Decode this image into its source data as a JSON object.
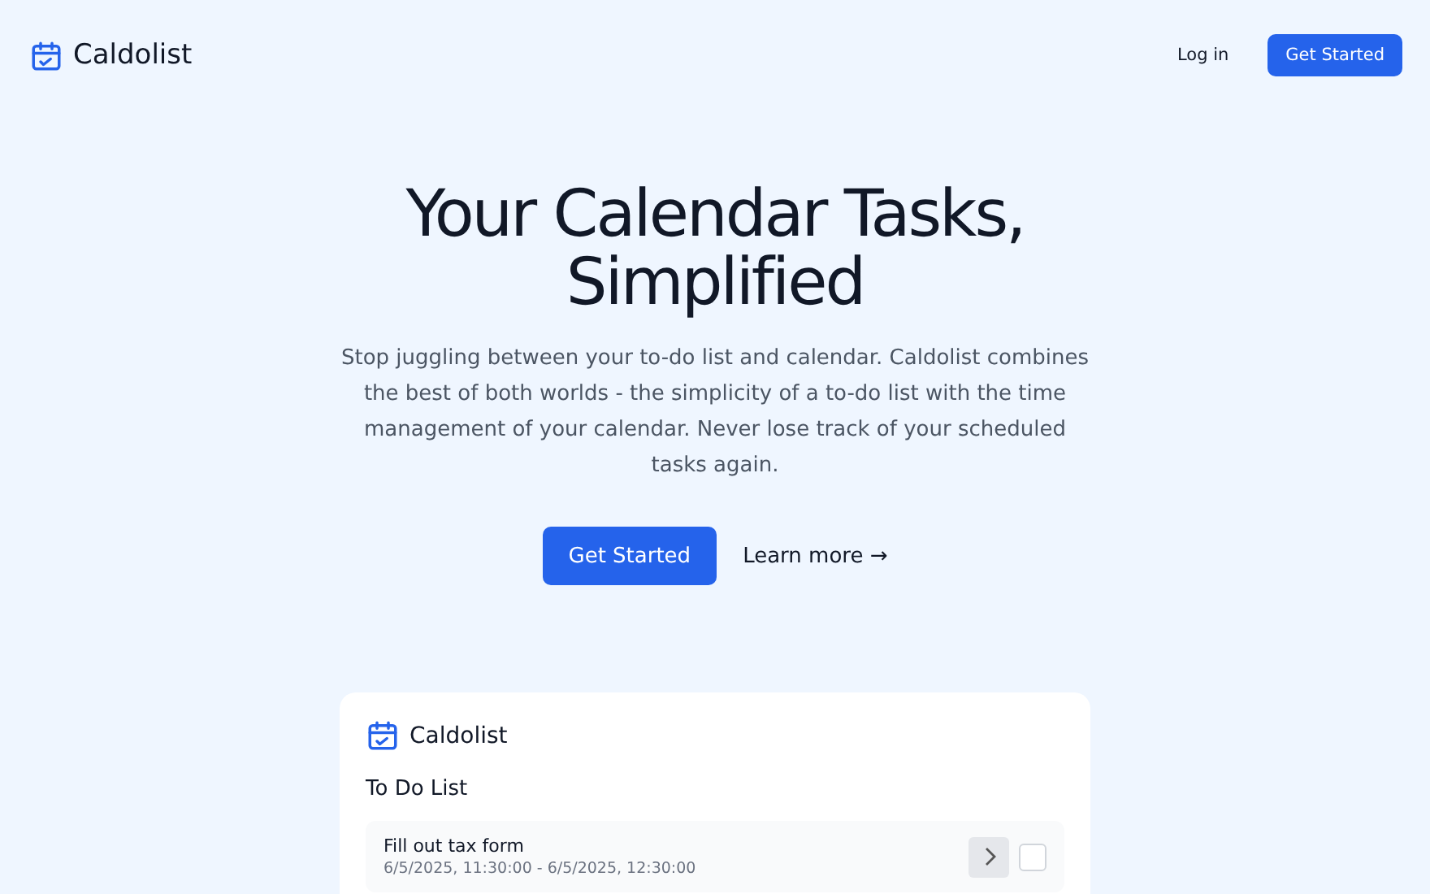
{
  "nav": {
    "brand": "Caldolist",
    "login": "Log in",
    "cta": "Get Started"
  },
  "hero": {
    "title_lines": [
      "Your Calendar Tasks,",
      "Simplified"
    ],
    "description": "Stop juggling between your to-do list and calendar. Caldolist combines the best of both worlds - the simplicity of a to-do list with the time management of your calendar. Never lose track of your scheduled tasks again.",
    "primary": "Get Started",
    "secondary": "Learn more →"
  },
  "preview": {
    "brand": "Caldolist",
    "heading": "To Do List",
    "tasks": [
      {
        "title": "Fill out tax form",
        "time": "6/5/2025, 11:30:00 - 6/5/2025, 12:30:00",
        "checked": false
      }
    ]
  }
}
